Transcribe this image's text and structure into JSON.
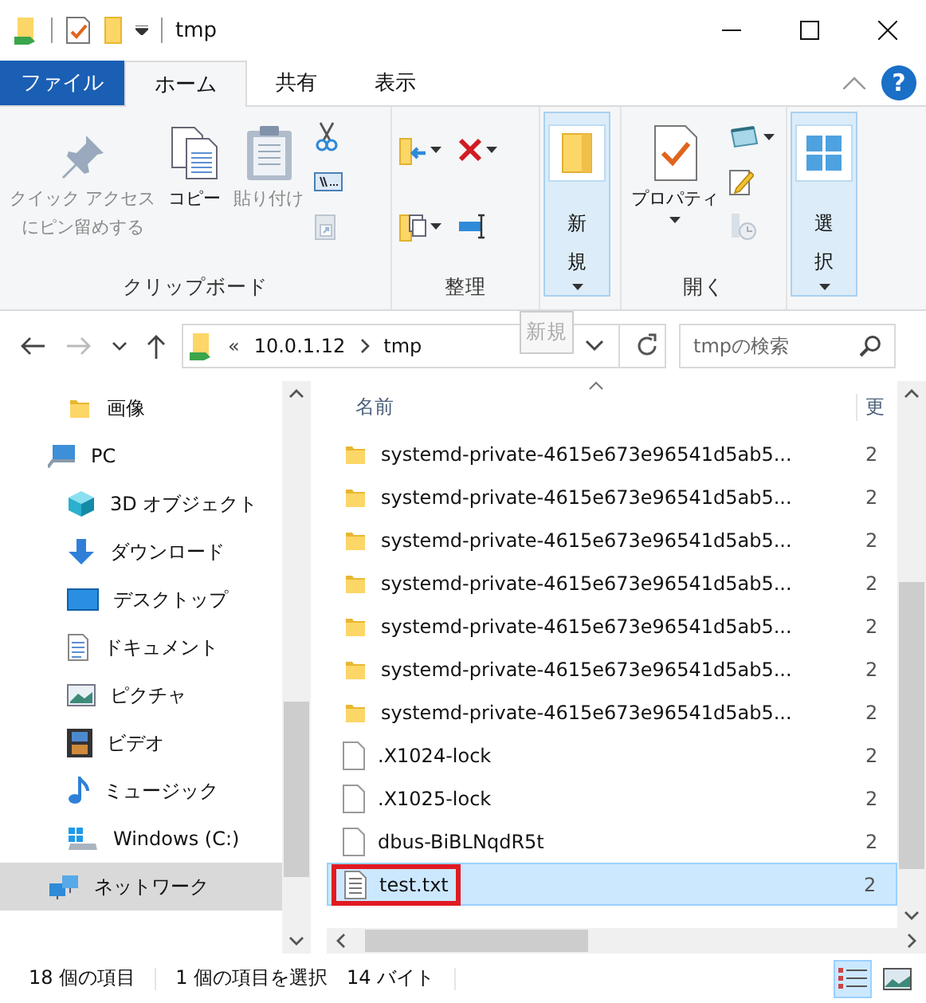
{
  "window": {
    "title": "tmp"
  },
  "tabs": [
    {
      "label": "ファイル",
      "kind": "file",
      "selected": false
    },
    {
      "label": "ホーム",
      "kind": "tab",
      "selected": true
    },
    {
      "label": "共有",
      "kind": "tab",
      "selected": false
    },
    {
      "label": "表示",
      "kind": "tab",
      "selected": false
    }
  ],
  "help": "?",
  "ribbon": [
    {
      "label": "クリップボード",
      "items": [
        {
          "kind": "pin",
          "label_lines": [
            "クイック アクセス",
            "にピン留めする"
          ],
          "disabled": true
        },
        {
          "kind": "copy",
          "label": "コピー",
          "disabled": false
        },
        {
          "kind": "paste",
          "label": "貼り付け",
          "disabled": true
        },
        {
          "kind": "stack",
          "buttons": [
            {
              "kind": "cut",
              "disabled": false
            },
            {
              "kind": "copy-path",
              "disabled": false
            },
            {
              "kind": "paste-shortcut",
              "disabled": true
            }
          ]
        }
      ]
    },
    {
      "label": "整理",
      "items": [
        {
          "kind": "grid",
          "buttons": [
            {
              "kind": "move-to",
              "dropdown": true,
              "disabled": false
            },
            {
              "kind": "delete",
              "dropdown": true,
              "disabled": false
            },
            {
              "kind": "copy-to",
              "dropdown": true,
              "disabled": false
            },
            {
              "kind": "rename",
              "disabled": false
            }
          ]
        }
      ]
    },
    {
      "items": [
        {
          "kind": "new",
          "label": "新規",
          "dropdown": true,
          "hovered": true
        }
      ]
    },
    {
      "label": "開く",
      "items": [
        {
          "kind": "properties",
          "label": "プロパティ",
          "dropdown": true
        },
        {
          "kind": "stack",
          "buttons": [
            {
              "kind": "open",
              "dropdown": true,
              "disabled": false
            },
            {
              "kind": "edit",
              "disabled": false
            },
            {
              "kind": "history",
              "disabled": true
            }
          ]
        }
      ]
    },
    {
      "items": [
        {
          "kind": "select",
          "label": "選択",
          "dropdown": true,
          "hovered": true
        }
      ]
    }
  ],
  "address": {
    "overflow": "«",
    "path": [
      "10.0.1.12",
      "tmp"
    ],
    "drag_ghost": "新規"
  },
  "search": {
    "placeholder": "tmpの検索"
  },
  "nav": [
    {
      "label": "画像",
      "kind": "folder",
      "selected": false
    },
    {
      "label": "PC",
      "kind": "pc",
      "selected": false,
      "children": [
        {
          "label": "3D オブジェクト",
          "kind": "cube",
          "selected": false
        },
        {
          "label": "ダウンロード",
          "kind": "download",
          "selected": false
        },
        {
          "label": "デスクトップ",
          "kind": "desktop",
          "selected": false
        },
        {
          "label": "ドキュメント",
          "kind": "document",
          "selected": false
        },
        {
          "label": "ピクチャ",
          "kind": "pictures",
          "selected": false
        },
        {
          "label": "ビデオ",
          "kind": "video",
          "selected": false
        },
        {
          "label": "ミュージック",
          "kind": "music",
          "selected": false
        },
        {
          "label": "Windows (C:)",
          "kind": "drive",
          "selected": false
        }
      ]
    },
    {
      "label": "ネットワーク",
      "kind": "network",
      "selected": true
    }
  ],
  "files": {
    "columns": [
      "名前",
      "更"
    ],
    "rows": [
      {
        "name": "systemd-private-4615e673e96541d5ab5...",
        "column_2": "2",
        "kind": "folder",
        "selected": false,
        "outlined": false
      },
      {
        "name": "systemd-private-4615e673e96541d5ab5...",
        "column_2": "2",
        "kind": "folder",
        "selected": false,
        "outlined": false
      },
      {
        "name": "systemd-private-4615e673e96541d5ab5...",
        "column_2": "2",
        "kind": "folder",
        "selected": false,
        "outlined": false
      },
      {
        "name": "systemd-private-4615e673e96541d5ab5...",
        "column_2": "2",
        "kind": "folder",
        "selected": false,
        "outlined": false
      },
      {
        "name": "systemd-private-4615e673e96541d5ab5...",
        "column_2": "2",
        "kind": "folder",
        "selected": false,
        "outlined": false
      },
      {
        "name": "systemd-private-4615e673e96541d5ab5...",
        "column_2": "2",
        "kind": "folder",
        "selected": false,
        "outlined": false
      },
      {
        "name": "systemd-private-4615e673e96541d5ab5...",
        "column_2": "2",
        "kind": "folder",
        "selected": false,
        "outlined": false
      },
      {
        "name": ".X1024-lock",
        "column_2": "2",
        "kind": "file",
        "selected": false,
        "outlined": false
      },
      {
        "name": ".X1025-lock",
        "column_2": "2",
        "kind": "file",
        "selected": false,
        "outlined": false
      },
      {
        "name": "dbus-BiBLNqdR5t",
        "column_2": "2",
        "kind": "file",
        "selected": false,
        "outlined": false
      },
      {
        "name": "test.txt",
        "column_2": "2",
        "kind": "text",
        "selected": true,
        "outlined": true
      }
    ]
  },
  "status": {
    "count": "18 個の項目",
    "selection": "1 個の項目を選択",
    "size": "14 バイト"
  },
  "views": [
    {
      "kind": "details",
      "selected": true
    },
    {
      "kind": "large",
      "selected": false
    }
  ]
}
